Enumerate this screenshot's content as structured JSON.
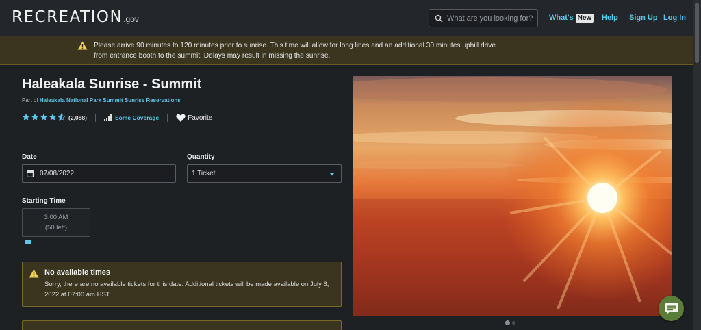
{
  "header": {
    "logo_text": "RECREATION",
    "logo_suffix": ".gov",
    "search_placeholder": "What are you looking for?",
    "nav": {
      "whats_new": "What's",
      "new_badge": "New",
      "help": "Help",
      "sign_up": "Sign Up",
      "log_in": "Log In"
    }
  },
  "banner": {
    "text": "Please arrive 90 minutes to 120 minutes prior to sunrise. This time will allow for long lines and an additional 30 minutes uphill drive from entrance booth to the summit. Delays may result in missing the sunrise."
  },
  "page": {
    "title": "Haleakala Sunrise - Summit",
    "part_of_prefix": "Part of",
    "part_of_link": "Haleakala National Park Summit Sunrise Reservations",
    "rating_stars": 4.5,
    "rating_count": "(2,088)",
    "coverage": "Some Coverage",
    "favorite": "Favorite"
  },
  "form": {
    "date_label": "Date",
    "date_value": "07/08/2022",
    "quantity_label": "Quantity",
    "quantity_value": "1 Ticket",
    "starting_time_label": "Starting Time",
    "slot_time": "3:00 AM",
    "slot_left": "(50 left)"
  },
  "notice": {
    "title": "No available times",
    "body": "Sorry, there are no available tickets for this date. Additional tickets will be made available on July 6, 2022 at 07:00 am HST."
  },
  "colors": {
    "accent": "#5ec8ec",
    "warning_bg": "#3b3520",
    "warning_border": "#7a6a2a",
    "background": "#1e2124",
    "chat_button": "#5a7d3a"
  },
  "icons": {
    "search": "search-icon",
    "warning": "warning-icon",
    "calendar": "calendar-icon",
    "dropdown": "caret-down-icon",
    "coverage": "signal-bars-icon",
    "favorite": "heart-icon",
    "chat": "chat-bubble-icon"
  }
}
